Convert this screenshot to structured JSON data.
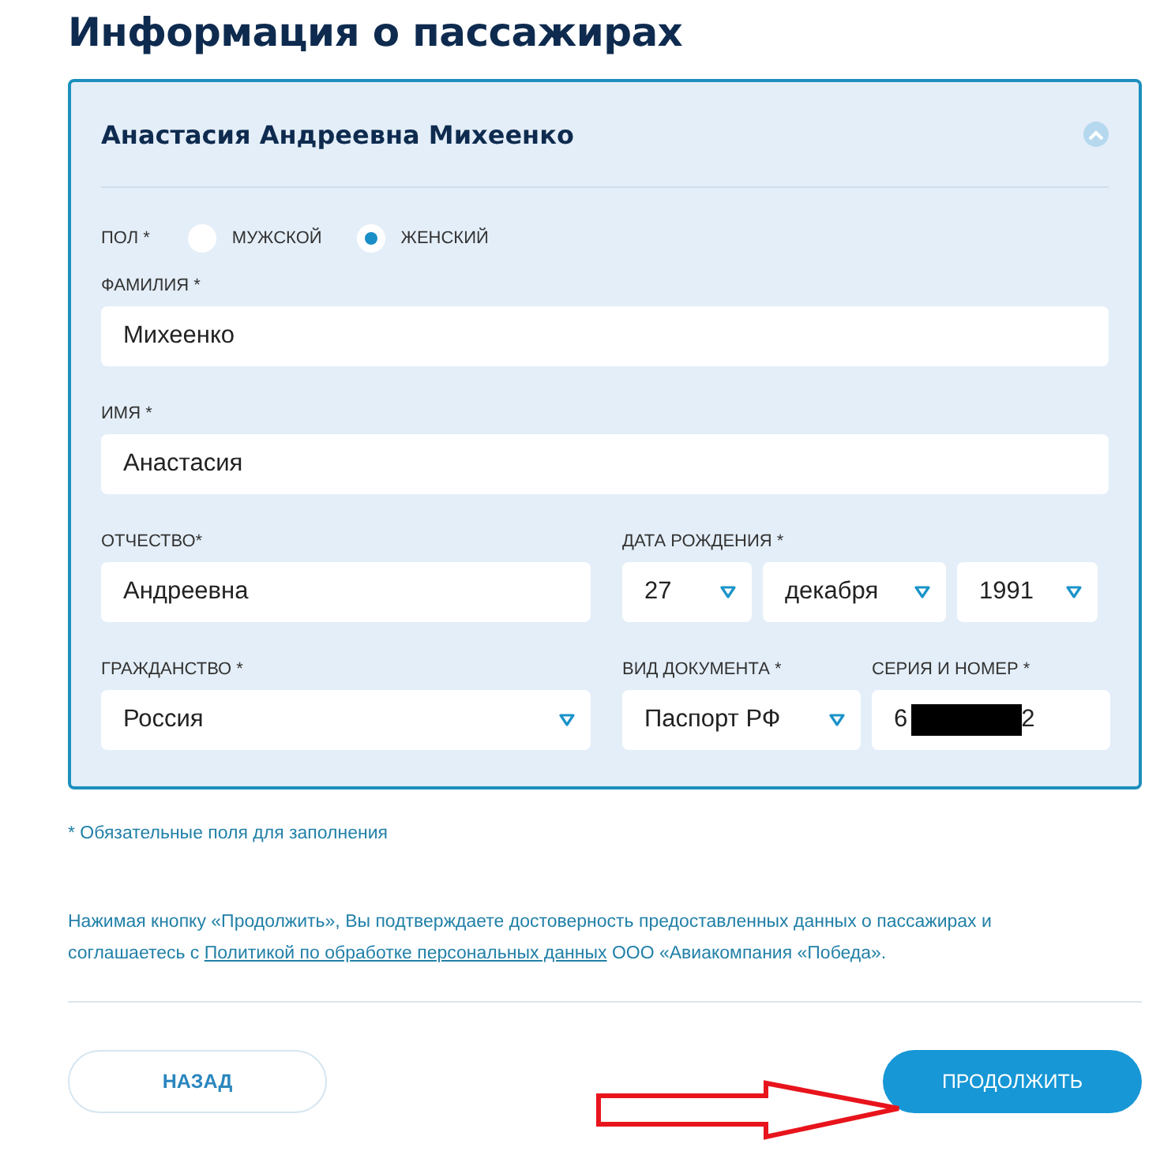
{
  "page_title": "Информация о пассажирах",
  "passenger": {
    "name": "Анастасия Андреевна Михеенко",
    "expanded": true,
    "gender": {
      "label": "ПОЛ *",
      "options": [
        {
          "label": "МУЖСКОЙ",
          "selected": false
        },
        {
          "label": "ЖЕНСКИЙ",
          "selected": true
        }
      ]
    },
    "rows": [
      [
        {
          "label": "ФАМИЛИЯ *",
          "fields": [
            {
              "kind": "text",
              "value": "Михеенко"
            }
          ]
        }
      ],
      [
        {
          "label": "ИМЯ *",
          "fields": [
            {
              "kind": "text",
              "value": "Анастасия"
            }
          ]
        }
      ],
      [
        {
          "label": "ОТЧЕСТВО*",
          "fields": [
            {
              "kind": "text",
              "value": "Андреевна"
            }
          ]
        },
        {
          "label": "ДАТА РОЖДЕНИЯ *",
          "fields": [
            {
              "kind": "select",
              "value": "27"
            },
            {
              "kind": "select",
              "value": "декабря"
            },
            {
              "kind": "select",
              "value": "1991"
            }
          ]
        }
      ],
      [
        {
          "label": "ГРАЖДАНСТВО *",
          "fields": [
            {
              "kind": "select",
              "value": "Россия"
            }
          ]
        },
        {
          "label": "ВИД ДОКУМЕНТА *",
          "fields": [
            {
              "kind": "select",
              "value": "Паспорт РФ"
            }
          ]
        },
        {
          "label": "СЕРИЯ И НОМЕР *",
          "fields": [
            {
              "kind": "redacted",
              "value": "6",
              "tail": "2"
            }
          ]
        }
      ]
    ]
  },
  "required_note": "* Обязательные поля для заполнения",
  "consent": {
    "before": "Нажимая кнопку «Продолжить», Вы подтверждаете достоверность предоставленных данных о пассажирах и соглашаетесь с ",
    "link": "Политикой по обработке персональных данных",
    "after": " ООО «Авиакомпания «Победа»."
  },
  "buttons": [
    {
      "kind": "secondary",
      "label": "НАЗАД"
    },
    {
      "kind": "primary",
      "label": "ПРОДОЛЖИТЬ"
    }
  ],
  "annotation": {
    "kind": "arrow"
  }
}
